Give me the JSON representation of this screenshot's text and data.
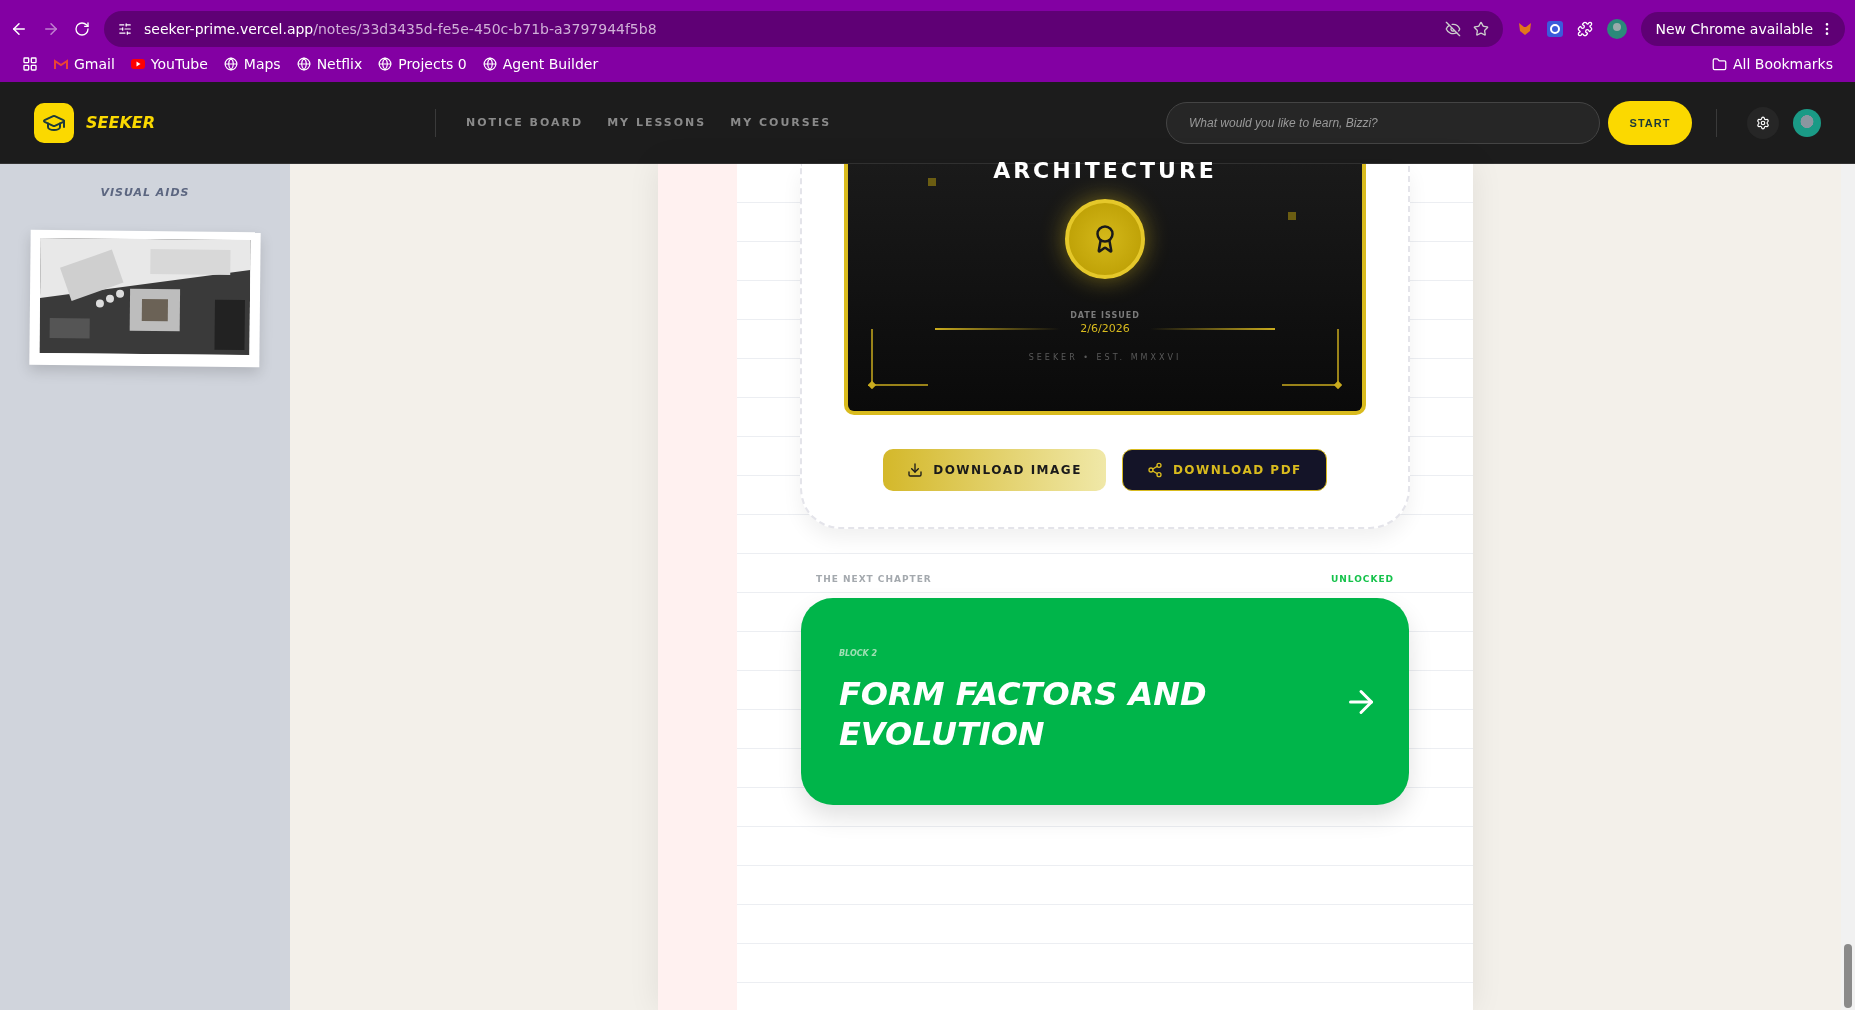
{
  "browser": {
    "url_host": "seeker-prime.vercel.app",
    "url_path": "/notes/33d3435d-fe5e-450c-b71b-a3797944f5b8",
    "update": "New Chrome available",
    "bookmarks": [
      {
        "label": "Gmail",
        "kind": "gmail"
      },
      {
        "label": "YouTube",
        "kind": "youtube"
      },
      {
        "label": "Maps",
        "kind": "globe"
      },
      {
        "label": "Netflix",
        "kind": "globe"
      },
      {
        "label": "Projects 0",
        "kind": "globe"
      },
      {
        "label": "Agent Builder",
        "kind": "globe"
      }
    ],
    "all_bookmarks": "All Bookmarks"
  },
  "header": {
    "logo": "SEEKER",
    "nav": [
      {
        "label": "NOTICE BOARD"
      },
      {
        "label": "MY LESSONS"
      },
      {
        "label": "MY COURSES"
      }
    ],
    "search": {
      "placeholder": "What would you like to learn, Bizzi?"
    },
    "start": "START"
  },
  "sidebar": {
    "title": "VISUAL AIDS"
  },
  "certificate": {
    "title": "ARCHITECTURE",
    "date_label": "DATE ISSUED",
    "date": "2/6/2026",
    "footer": "SEEKER • EST. MMXXVI"
  },
  "actions": [
    {
      "label": "DOWNLOAD IMAGE",
      "kind": "download"
    },
    {
      "label": "DOWNLOAD PDF",
      "kind": "share"
    }
  ],
  "next_chapter": {
    "label": "THE NEXT CHAPTER",
    "status": "UNLOCKED",
    "block": "BLOCK 2",
    "title": "FORM FACTORS AND EVOLUTION"
  }
}
